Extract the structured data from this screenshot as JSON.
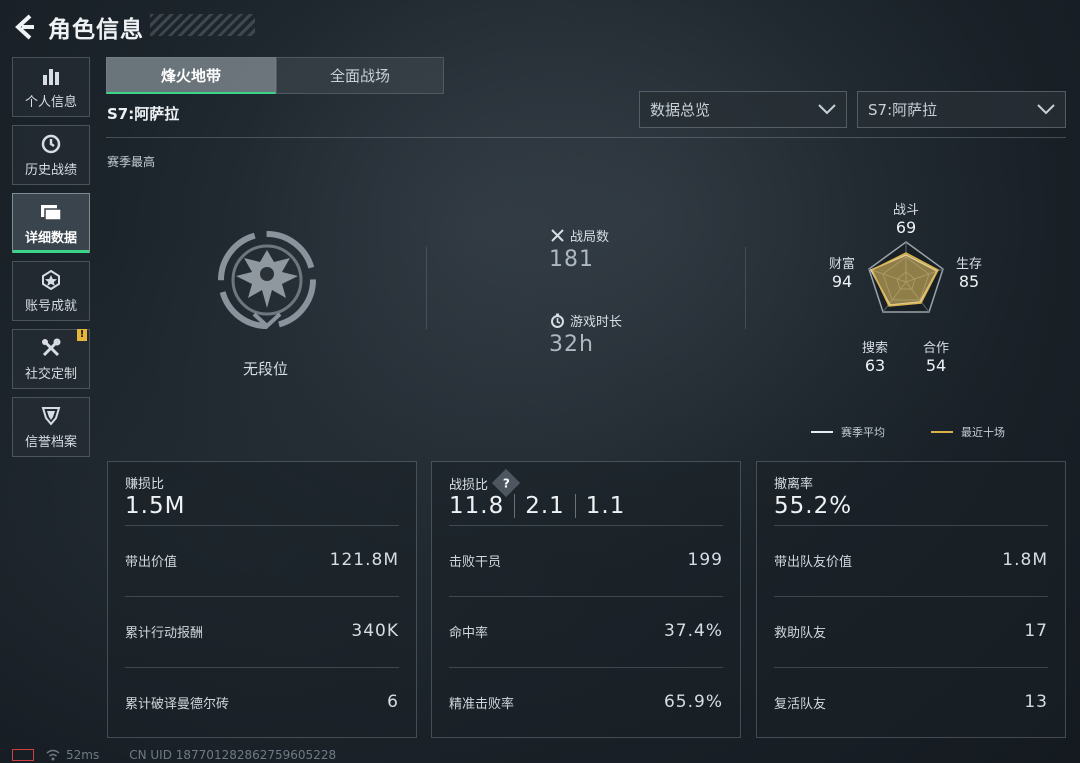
{
  "header": {
    "title": "角色信息"
  },
  "sidebar": {
    "items": [
      {
        "label": "个人信息",
        "icon": "bar-chart-icon",
        "active": false
      },
      {
        "label": "历史战绩",
        "icon": "clock-icon",
        "active": false
      },
      {
        "label": "详细数据",
        "icon": "folder-icon",
        "active": true
      },
      {
        "label": "账号成就",
        "icon": "medal-icon",
        "active": false
      },
      {
        "label": "社交定制",
        "icon": "tools-icon",
        "active": false,
        "badge": "!"
      },
      {
        "label": "信誉档案",
        "icon": "shield-icon",
        "active": false
      }
    ]
  },
  "tabs": [
    {
      "label": "烽火地带",
      "active": true
    },
    {
      "label": "全面战场",
      "active": false
    }
  ],
  "season": {
    "label": "S7:阿萨拉"
  },
  "dropdowns": {
    "view": {
      "value": "数据总览"
    },
    "season": {
      "value": "S7:阿萨拉"
    }
  },
  "section": {
    "label": "赛季最高"
  },
  "rank": {
    "text": "无段位"
  },
  "stats": {
    "matches": {
      "label": "战局数",
      "value": "181"
    },
    "playtime": {
      "label": "游戏时长",
      "value": "32h"
    }
  },
  "radar": {
    "axes": [
      {
        "name": "战斗",
        "value": "69"
      },
      {
        "name": "生存",
        "value": "85"
      },
      {
        "name": "合作",
        "value": "54"
      },
      {
        "name": "搜索",
        "value": "63"
      },
      {
        "name": "财富",
        "value": "94"
      }
    ],
    "legend": [
      {
        "label": "赛季平均",
        "color": "#e6ecf0"
      },
      {
        "label": "最近十场",
        "color": "#d9b24c"
      }
    ]
  },
  "cards": {
    "profit": {
      "title": "赚损比",
      "big": "1.5M",
      "rows": [
        {
          "k": "带出价值",
          "v": "121.8M"
        },
        {
          "k": "累计行动报酬",
          "v": "340K"
        },
        {
          "k": "累计破译曼德尔砖",
          "v": "6"
        }
      ]
    },
    "combat": {
      "title": "战损比",
      "big": [
        "11.8",
        "2.1",
        "1.1"
      ],
      "rows": [
        {
          "k": "击败干员",
          "v": "199"
        },
        {
          "k": "命中率",
          "v": "37.4%"
        },
        {
          "k": "精准击败率",
          "v": "65.9%"
        }
      ]
    },
    "extract": {
      "title": "撤离率",
      "big": "55.2%",
      "rows": [
        {
          "k": "带出队友价值",
          "v": "1.8M"
        },
        {
          "k": "救助队友",
          "v": "17"
        },
        {
          "k": "复活队友",
          "v": "13"
        }
      ]
    }
  },
  "footer": {
    "ping": "52ms",
    "uid": "CN UID 1877012828627596052​28"
  }
}
